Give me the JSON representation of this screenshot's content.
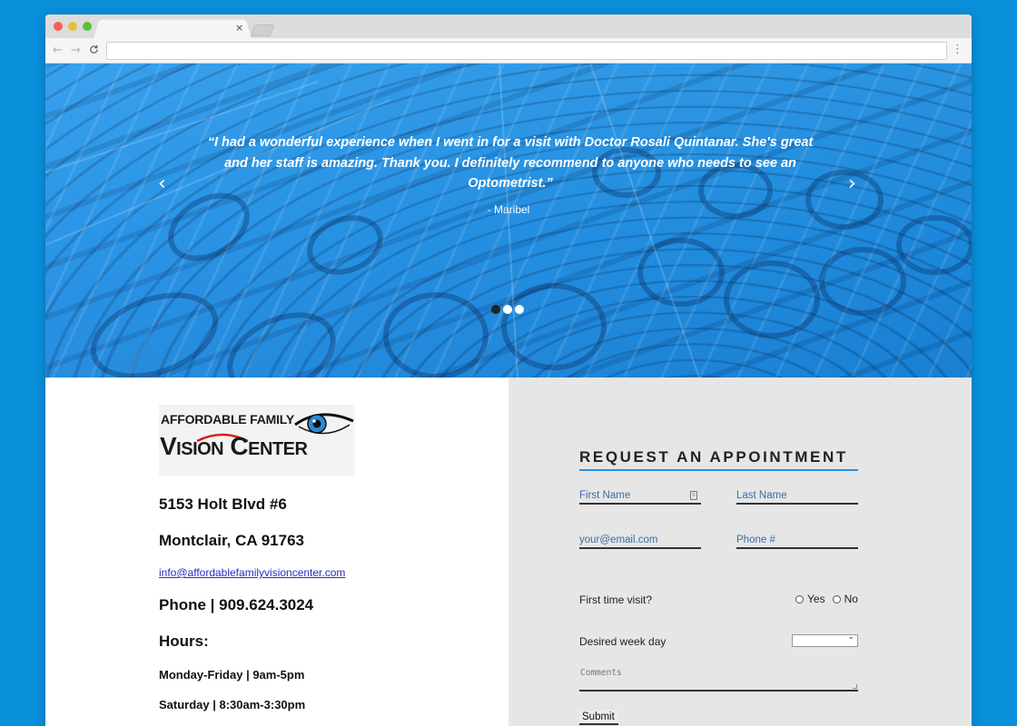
{
  "browser": {
    "tab_close": "×",
    "nav": {
      "back": "←",
      "forward": "→",
      "reload": "C"
    },
    "menu": "⋮"
  },
  "hero": {
    "quote": "“I had a wonderful experience when I went in for a visit with Doctor Rosali Quintanar. She's great and her staff is amazing. Thank you. I definitely recommend to anyone who needs to see an Optometrist.”",
    "author": "- Maribel",
    "prev_arrow": "‹",
    "next_arrow": "›",
    "slides": 3,
    "active_slide": 1
  },
  "logo": {
    "line1": "AFFORDABLE FAMILY",
    "line2": "Vision Center"
  },
  "contact": {
    "address_line1": "5153 Holt Blvd #6",
    "address_line2": "Montclair, CA 91763",
    "email": "info@affordablefamilyvisioncenter.com",
    "phone": "Phone | 909.624.3024",
    "hours_heading": "Hours:",
    "hours_weekday": "Monday-Friday | 9am-5pm",
    "hours_saturday": "Saturday | 8:30am-3:30pm"
  },
  "form": {
    "title": "REQUEST AN APPOINTMENT",
    "first_name_placeholder": "First Name",
    "last_name_placeholder": "Last Name",
    "email_placeholder": "your@email.com",
    "phone_placeholder": "Phone #",
    "first_visit_label": "First time visit?",
    "yes_label": "Yes",
    "no_label": "No",
    "week_day_label": "Desired week day",
    "week_day_value": "",
    "comments_placeholder": "Comments",
    "submit_label": "Submit"
  },
  "colors": {
    "page_background": "#0a8fdb",
    "hero_blue": "#1e8fe6",
    "form_background": "#e6e6e6",
    "accent_underline": "#2b8fd9",
    "link": "#2a2ad0"
  }
}
